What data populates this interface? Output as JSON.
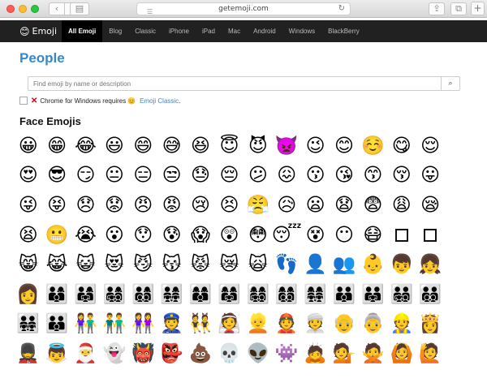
{
  "browser": {
    "url": "getemoji.com",
    "back_icon": "‹",
    "forward_icon": "›",
    "sidebar_icon": "▤",
    "reload_icon": "↻",
    "share_icon": "⇪",
    "tabs_icon": "⧉",
    "new_tab_icon": "+"
  },
  "nav": {
    "brand_icon": "😊",
    "brand": "Emoji",
    "items": [
      "All Emoji",
      "Blog",
      "Classic",
      "iPhone",
      "iPad",
      "Mac",
      "Android",
      "Windows",
      "BlackBerry"
    ],
    "active_index": 0
  },
  "page": {
    "title": "People",
    "search_placeholder": "Find emoji by name or description",
    "search_icon": "🔍",
    "notice_icon": "✕",
    "notice_text": "Chrome for Windows requires",
    "notice_emoji": "😊",
    "notice_link": "Emoji Classic",
    "notice_tail": ".",
    "section_title": "Face Emojis"
  },
  "emoji_rows": [
    [
      "😀",
      "😁",
      "😂",
      "😃",
      "😄",
      "😅",
      "😆",
      "😇",
      "😈",
      "👿",
      "😉",
      "😊",
      "☺️",
      "😋",
      "😌"
    ],
    [
      "😍",
      "😎",
      "😏",
      "😐",
      "😑",
      "😒",
      "😓",
      "😔",
      "😕",
      "😖",
      "😗",
      "😘",
      "😙",
      "😚",
      "😛"
    ],
    [
      "😜",
      "😝",
      "😞",
      "😟",
      "😠",
      "😡",
      "😢",
      "😣",
      "😤",
      "😥",
      "😦",
      "😧",
      "😨",
      "😩",
      "😪"
    ],
    [
      "😫",
      "😬",
      "😭",
      "😮",
      "😯",
      "😰",
      "😱",
      "😲",
      "😳",
      "😴",
      "😵",
      "😶",
      "😷",
      "☐",
      "☐"
    ],
    [
      "😸",
      "😹",
      "😺",
      "😻",
      "😼",
      "😽",
      "😾",
      "😿",
      "🙀",
      "👣",
      "👤",
      "👥",
      "👶",
      "👦",
      "👧"
    ],
    [
      "👩",
      "👨‍👩‍👦",
      "👨‍👩‍👧",
      "👨‍👩‍👧‍👦",
      "👨‍👩‍👦‍👦",
      "👨‍👩‍👧‍👧",
      "👩‍👩‍👦",
      "👩‍👩‍👧",
      "👩‍👩‍👧‍👦",
      "👩‍👩‍👦‍👦",
      "👩‍👩‍👧‍👧",
      "👨‍👨‍👦",
      "👨‍👨‍👧",
      "👨‍👨‍👧‍👦",
      "👨‍👨‍👦‍👦"
    ],
    [
      "👨‍👨‍👧‍👧",
      "👪",
      "👫",
      "👬",
      "👭",
      "👮",
      "👯",
      "👰",
      "👱",
      "👲",
      "👳",
      "👴",
      "👵",
      "👷",
      "👸"
    ],
    [
      "💂",
      "👼",
      "🎅",
      "👻",
      "👹",
      "👺",
      "💩",
      "💀",
      "👽",
      "👾",
      "🙇",
      "💁",
      "🙅",
      "🙆",
      "🙋"
    ]
  ]
}
